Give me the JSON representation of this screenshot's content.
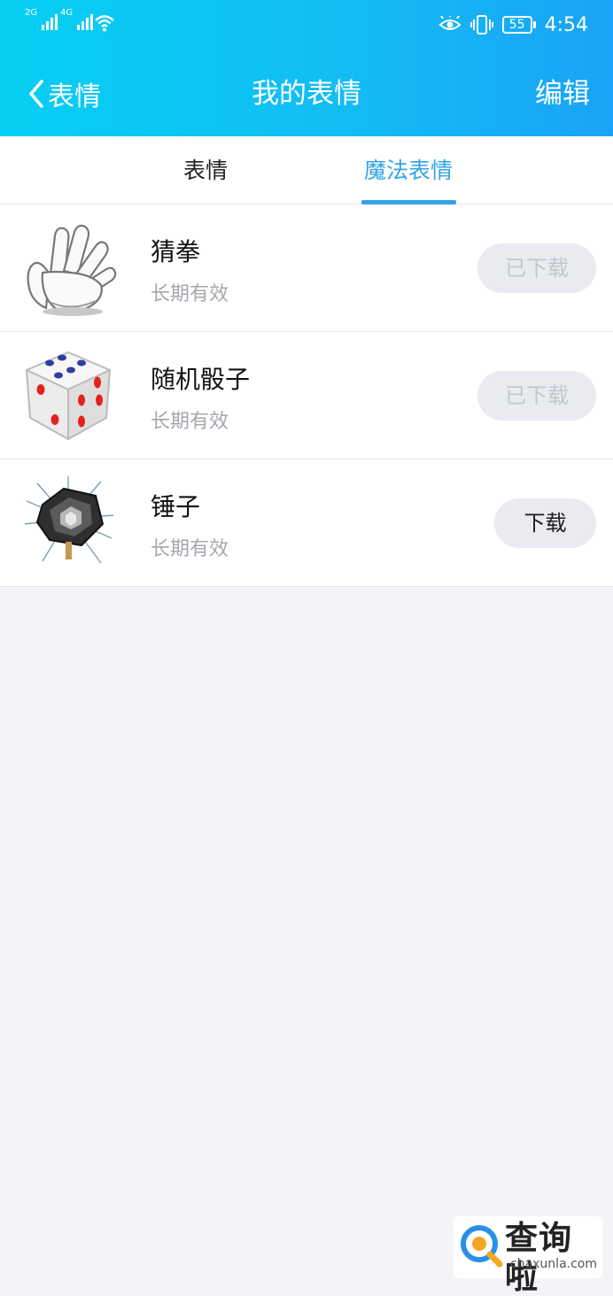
{
  "status_bar": {
    "sim1_tag": "2G",
    "sim2_tag": "4G",
    "battery_level": "55",
    "time": "4:54",
    "icons": [
      "signal-icon",
      "wifi-icon",
      "eye-comfort-icon",
      "vibrate-icon",
      "battery-icon"
    ]
  },
  "header": {
    "back_label": "表情",
    "title": "我的表情",
    "edit_label": "编辑"
  },
  "tabs": [
    {
      "label": "表情",
      "active": false
    },
    {
      "label": "魔法表情",
      "active": true
    }
  ],
  "items": [
    {
      "name": "猜拳",
      "validity": "长期有效",
      "button": "已下载",
      "downloaded": true,
      "icon": "glove-hand-icon"
    },
    {
      "name": "随机骰子",
      "validity": "长期有效",
      "button": "已下载",
      "downloaded": true,
      "icon": "dice-icon"
    },
    {
      "name": "锤子",
      "validity": "长期有效",
      "button": "下载",
      "downloaded": false,
      "icon": "hammer-icon"
    }
  ],
  "watermark": {
    "name": "查询啦",
    "url": "chaxunla.com"
  },
  "colors": {
    "header_start": "#06cff3",
    "header_end": "#1aa3f6",
    "accent": "#35a3e8",
    "background": "#f2f4f8"
  }
}
